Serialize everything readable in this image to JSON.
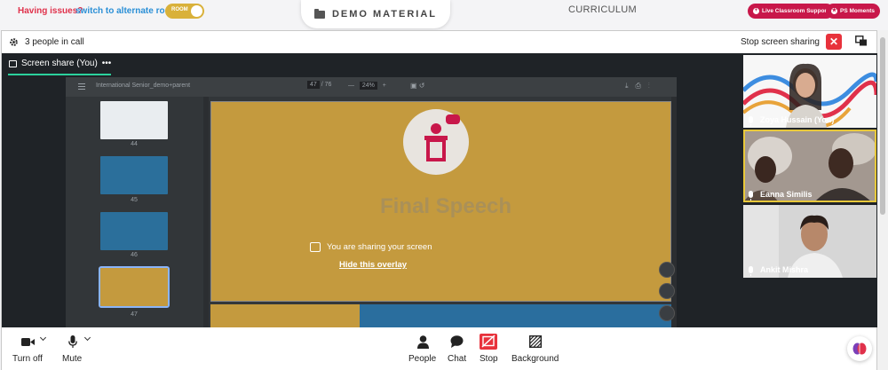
{
  "topbar": {
    "issues_text": "Having issues?",
    "alternate_link": "switch to alternate room",
    "room_toggle_label": "ROOM",
    "demo_tab_label": "DEMO MATERIAL",
    "curriculum_label": "CURRICULUM",
    "live_support_label": "Live Classroom Support",
    "ps_moments_label": "PS Moments"
  },
  "callbar": {
    "people_count": "3 people in call",
    "stop_sharing_label": "Stop screen sharing",
    "close_symbol": "✕"
  },
  "share": {
    "tab_label": "Screen share (You)",
    "tab_menu": "•••",
    "overlay_message": "You are sharing your screen",
    "hide_overlay_label": "Hide this overlay"
  },
  "pdf": {
    "title": "International Senior_demo+parent",
    "page_current": "47",
    "page_total": "/ 76",
    "zoom": "24%",
    "zoom_minus": "—",
    "zoom_plus": "+",
    "thumbnails": [
      {
        "num": "44",
        "color": "#e9edf0"
      },
      {
        "num": "45",
        "color": "#2b6f9b"
      },
      {
        "num": "46",
        "color": "#2b6f9b"
      },
      {
        "num": "47",
        "color": "#c49a3e"
      }
    ],
    "slide_title": "Final Speech"
  },
  "participants": [
    {
      "name": "Zoya Hussain (You)",
      "bg": "#f7f7f7",
      "highlight": false
    },
    {
      "name": "Eanna Similis",
      "bg": "#6b6260",
      "highlight": true
    },
    {
      "name": "Ankit Mishra",
      "bg": "#cfcfcf",
      "highlight": false
    }
  ],
  "controls": {
    "turn_off": "Turn off",
    "mute": "Mute",
    "people": "People",
    "chat": "Chat",
    "stop": "Stop",
    "background": "Background"
  },
  "colors": {
    "accent_green": "#2bd19d",
    "danger_red": "#e8323c",
    "brand_pink": "#c8174a",
    "toggle_gold": "#d9b13a"
  }
}
